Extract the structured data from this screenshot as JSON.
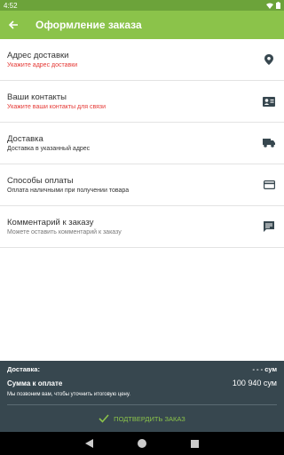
{
  "status_bar": {
    "time": "4:52"
  },
  "app_bar": {
    "title": "Оформление заказа"
  },
  "rows": [
    {
      "label": "Адрес доставки",
      "sub": "Укажите адрес доставки",
      "icon": "location-pin-icon"
    },
    {
      "label": "Ваши контакты",
      "sub": "Укажите ваши контакты для связи",
      "icon": "contact-card-icon"
    },
    {
      "label": "Доставка",
      "sub": "Доставка в указанный адрес",
      "icon": "truck-icon"
    },
    {
      "label": "Способы оплаты",
      "sub": "Оплата наличными при получении товара",
      "icon": "credit-card-icon"
    },
    {
      "label": "Комментарий к заказу",
      "sub": "Можете оставить комментарий к заказу",
      "icon": "comment-icon"
    }
  ],
  "footer": {
    "delivery_label": "Доставка:",
    "delivery_value": "- - - сум",
    "total_label": "Сумма к оплате",
    "total_value": "100 940 сум",
    "note": "Мы позвоним вам, чтобы уточнить итоговую цену.",
    "confirm_label": "ПОДТВЕРДИТЬ ЗАКАЗ"
  },
  "colors": {
    "primary": "#8bc34a",
    "status_bar": "#6ca33a",
    "error": "#e53935",
    "footer_bg": "#37474f"
  }
}
